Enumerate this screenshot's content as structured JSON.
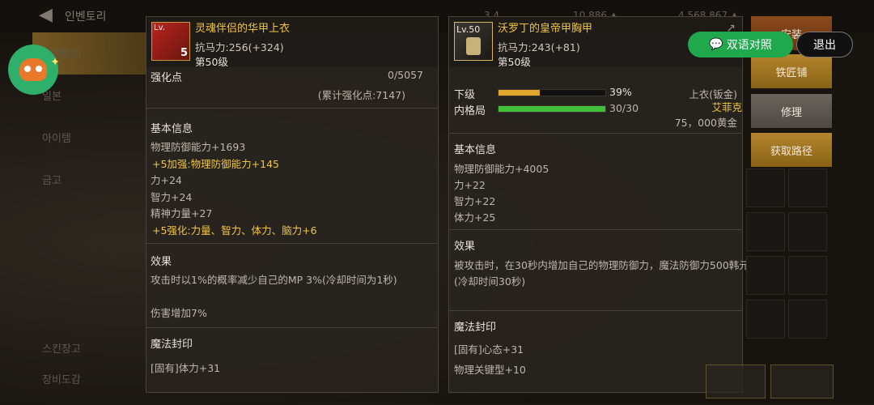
{
  "top": {
    "back_glyph": "◀",
    "title": "인벤토리",
    "cur1": "3,4",
    "cur2": "10,886 ▲",
    "cur3": "4,568,867 ▲"
  },
  "sidenav": {
    "items": [
      "인벤토리",
      "일본",
      "아이템",
      "금고",
      "스킨장고",
      "장비도감"
    ]
  },
  "item1": {
    "name": "灵魂伴侣的华甲上衣",
    "resist": "抗马力:256(+324)",
    "level": "第50级",
    "icon_lv": "Lv.",
    "icon_num": "5",
    "enhance_label": "强化点",
    "enhance_value": "0/5057",
    "enhance_total": "(累计强化点:7147)",
    "basic_header": "基本信息",
    "stats": [
      {
        "text": "物理防御能力+1693",
        "gold": false
      },
      {
        "text": "+5加强:物理防御能力+145",
        "gold": true
      },
      {
        "text": "力+24",
        "gold": false
      },
      {
        "text": "智力+24",
        "gold": false
      },
      {
        "text": "精神力量+27",
        "gold": false
      },
      {
        "text": "+5强化:力量、智力、体力、脑力+6",
        "gold": true
      }
    ],
    "effect_header": "效果",
    "effect_text": "攻击时以1%的概率减少自己的MP 3%(冷却时间为1秒)",
    "effect_text2": "伤害增加7%",
    "seal_header": "魔法封印",
    "seal_text": "[固有]体力+31"
  },
  "item2": {
    "name": "沃罗丁的皇帝甲胸甲",
    "resist": "抗马力:243(+81)",
    "level": "第50级",
    "icon_lv": "Lv.50",
    "bar1_label": "下级",
    "bar1_value": "39%",
    "bar1_pct": 39,
    "bar2_label": "内格局",
    "bar2_value": "30/30",
    "bar2_pct": 100,
    "type": "上衣(钣金)",
    "owner": "艾菲克",
    "price": "75，000黄金",
    "basic_header": "基本信息",
    "stats": [
      "物理防御能力+4005",
      "力+22",
      "智力+22",
      "体力+25"
    ],
    "effect_header": "效果",
    "effect_text": "被攻击时，在30秒内增加自己的物理防御力，魔法防御力500韩元",
    "effect_text2": "(冷却时间30秒)",
    "seal_header": "魔法封印",
    "seal_text": "[固有]心态+31",
    "seal_text2": "物理关键型+10"
  },
  "buttons": {
    "install": "安装",
    "smith": "铁匠铺",
    "repair": "修理",
    "obtain": "获取路径"
  },
  "overlay": {
    "bilingual": "双语对照",
    "exit": "退出"
  },
  "colors": {
    "gold": "#f0c542",
    "green_pill": "#20a84d",
    "bar_orange": "#e0a52a",
    "bar_green": "#3fbf3a"
  }
}
